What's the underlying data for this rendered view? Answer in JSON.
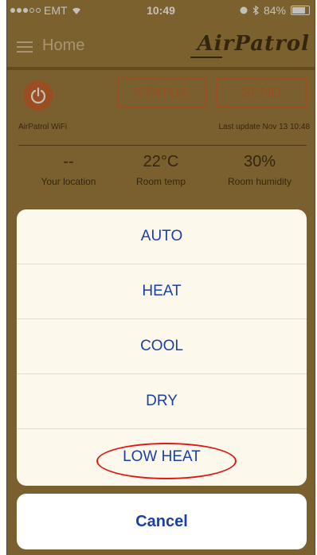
{
  "status_bar": {
    "carrier": "EMT",
    "time": "10:49",
    "battery": "84%"
  },
  "nav": {
    "title": "Home",
    "logo": "AirPatrol"
  },
  "controls": {
    "status_label": "STATUS",
    "send_label": "SEND"
  },
  "device": {
    "name": "AirPatrol WiFi",
    "last_update": "Last update Nov 13 10:48"
  },
  "stats": [
    {
      "value": "--",
      "label": "Your location"
    },
    {
      "value": "22°C",
      "label": "Room temp"
    },
    {
      "value": "30%",
      "label": "Room humidity"
    }
  ],
  "mode_sheet": {
    "options": [
      "AUTO",
      "HEAT",
      "COOL",
      "DRY",
      "LOW HEAT"
    ],
    "cancel_label": "Cancel"
  },
  "colors": {
    "accent": "#c8612a",
    "link": "#1a3fa8",
    "highlight": "#e01818"
  },
  "icons": [
    "wifi-icon",
    "alarm-icon",
    "bluetooth-icon",
    "battery-icon",
    "menu-icon",
    "power-icon"
  ]
}
